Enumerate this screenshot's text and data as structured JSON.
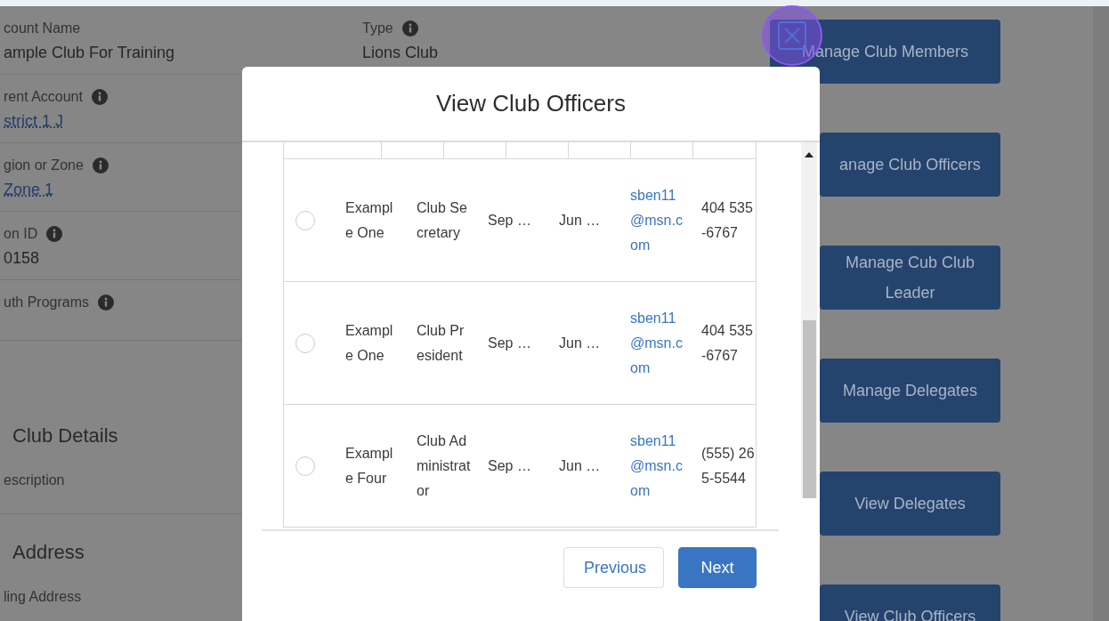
{
  "record": {
    "field_rows": [
      [
        {
          "label": "count Name",
          "value": "ample Club For Training",
          "kind": "text",
          "info": false
        },
        {
          "label": "Type",
          "value": "Lions Club",
          "kind": "text",
          "info": true
        }
      ],
      [
        {
          "label": "rent Account",
          "value": "strict 1 J",
          "kind": "link",
          "info": true
        }
      ],
      [
        {
          "label": "gion or Zone",
          "value": "Zone 1",
          "kind": "link",
          "info": true
        }
      ],
      [
        {
          "label": "on ID",
          "value": "0158",
          "kind": "text",
          "info": true
        }
      ],
      [
        {
          "label": "uth Programs",
          "info": true
        }
      ]
    ],
    "sections": [
      {
        "title": "Club Details",
        "fields": [
          {
            "label": "escription"
          }
        ]
      },
      {
        "title": "Address",
        "fields": [
          {
            "label": "ling Address"
          }
        ]
      }
    ]
  },
  "side_buttons": [
    {
      "label": "Manage Club Members",
      "covered": false
    },
    {
      "label": "anage Club Officers",
      "covered": true
    },
    {
      "label": "Manage Cub Club Leader",
      "covered": true
    },
    {
      "label": "Manage Delegates",
      "covered": true
    },
    {
      "label": "View Delegates",
      "covered": true
    },
    {
      "label": "View Club Officers",
      "covered": true
    }
  ],
  "modal": {
    "title": "View Club Officers",
    "rows": [
      {
        "selected": false,
        "name": "Example One",
        "role": "Club Secretary",
        "start": "Sep …",
        "end": "Jun …",
        "email": "sben11@msn.com",
        "phone": "404 535-6767"
      },
      {
        "selected": false,
        "name": "Example One",
        "role": "Club President",
        "start": "Sep …",
        "end": "Jun …",
        "email": "sben11@msn.com",
        "phone": "404 535-6767"
      },
      {
        "selected": false,
        "name": "Example Four",
        "role": "Club Administrator",
        "start": "Sep …",
        "end": "Jun …",
        "email": "sben11@msn.com",
        "phone": "(555) 265-5544"
      }
    ],
    "buttons": [
      {
        "label": "Previous",
        "kind": "neutral"
      },
      {
        "label": "Next",
        "kind": "brand"
      }
    ]
  }
}
